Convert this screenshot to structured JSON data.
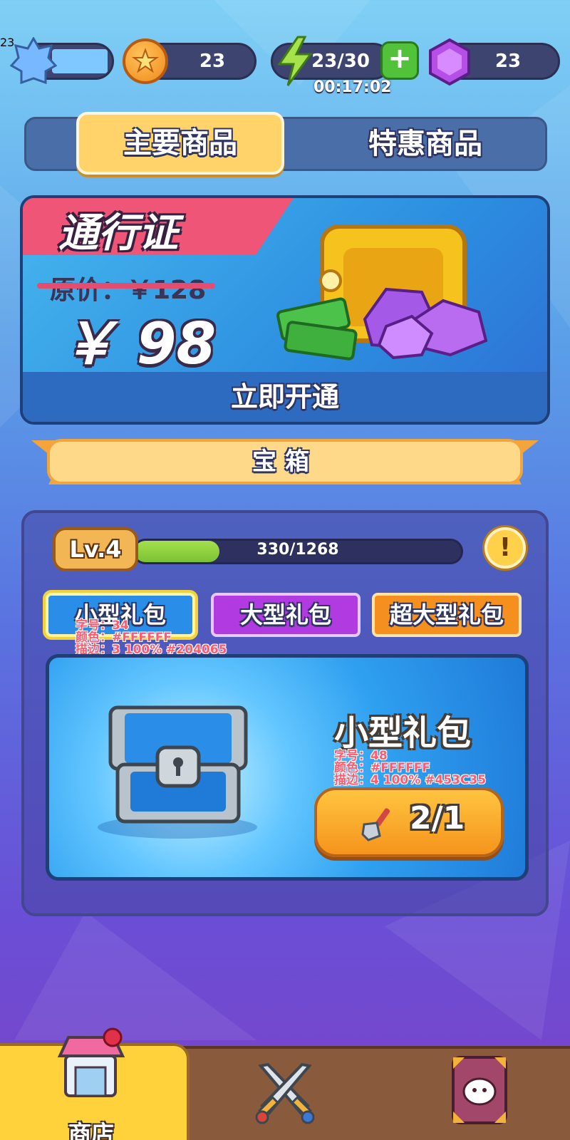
{
  "top_bar": {
    "level": "23",
    "coins": "23",
    "energy": "23/30",
    "energy_timer": "00:17:02",
    "gems": "23"
  },
  "tabs": {
    "main": "主要商品",
    "special": "特惠商品"
  },
  "pass": {
    "title": "通行证",
    "original_price": "原价：￥128",
    "price": "￥ 98",
    "cta": "立即开通"
  },
  "chest_section": {
    "title": "宝箱",
    "level": "Lv.4",
    "xp_text": "330/1268",
    "xp_progress": 0.26,
    "info_icon_text": "!",
    "package_tabs": [
      "小型礼包",
      "大型礼包",
      "超大型礼包"
    ],
    "tab_annotation": [
      "字号：34",
      "颜色：#FFFFFF",
      "描边：3 100% #204065"
    ],
    "card": {
      "title": "小型礼包",
      "annotation": [
        "字号：48",
        "颜色：#FFFFFF",
        "描边：4 100% #453C35"
      ],
      "open_count": "2/1"
    }
  },
  "bottom_nav": {
    "shop_label": "商店"
  },
  "colors": {
    "accent_yellow": "#ffd36a",
    "pass_pink": "#ef5577",
    "xp_green": "#7bc232",
    "package_small": "#2a8ee8",
    "package_big": "#b13be0",
    "package_xl": "#f58f1d"
  },
  "icons": [
    "star-badge-icon",
    "coin-icon",
    "lightning-icon",
    "plus-icon",
    "gem-icon",
    "info-icon",
    "shovel-icon",
    "chest-icon",
    "shop-icon",
    "crossed-swords-icon",
    "character-card-icon"
  ]
}
